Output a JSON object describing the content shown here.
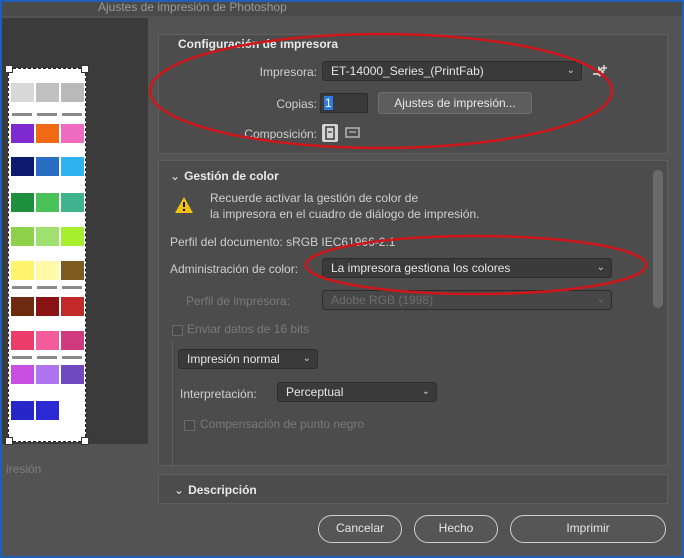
{
  "window": {
    "title": "Ajustes de impresión de Photoshop"
  },
  "preview": {
    "caption": "iresión"
  },
  "printer_setup": {
    "header": "Configuración de impresora",
    "printer_label": "Impresora:",
    "printer_value": "ET-14000_Series_(PrintFab)",
    "copies_label": "Copias:",
    "copies_value": "1",
    "print_settings_button": "Ajustes de impresión...",
    "layout_label": "Composición:"
  },
  "color_management": {
    "header": "Gestión de color",
    "warning_line1": "Recuerde activar la gestión de color de",
    "warning_line2": "la impresora en el cuadro de diálogo de impresión.",
    "document_profile": "Perfil del documento: sRGB IEC61966-2.1",
    "color_handling_label": "Administración de color:",
    "color_handling_value": "La impresora gestiona los colores",
    "printer_profile_label": "Perfil de impresora:",
    "printer_profile_value": "Adobe RGB (1998)",
    "send_16bit_label": "Enviar datos de 16 bits",
    "print_mode_value": "Impresión normal",
    "rendering_intent_label": "Interpretación:",
    "rendering_intent_value": "Perceptual",
    "black_point_label": "Compensación de punto negro"
  },
  "description": {
    "header": "Descripción"
  },
  "buttons": {
    "cancel": "Cancelar",
    "done": "Hecho",
    "print": "Imprimir"
  },
  "colors": {
    "annotation": "#d0161b",
    "accent": "#1f5fb8",
    "warning": "#f2c20f"
  }
}
